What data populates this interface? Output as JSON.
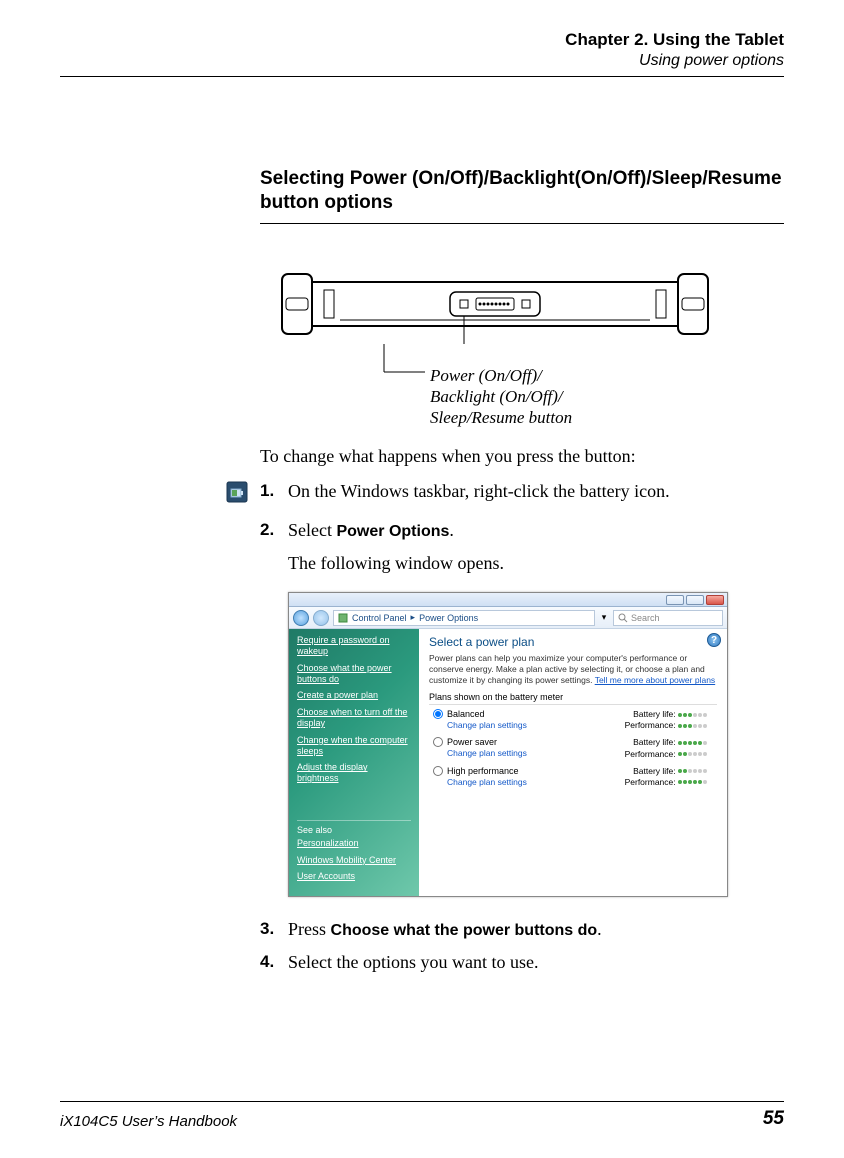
{
  "header": {
    "chapter": "Chapter 2. Using the Tablet",
    "subsection": "Using power options"
  },
  "heading": "Selecting Power (On/Off)/Backlight(On/Off)/Sleep/Resume button options",
  "callout": {
    "line1": "Power (On/Off)/",
    "line2": "Backlight (On/Off)/",
    "line3": "Sleep/Resume button"
  },
  "intro": "To change what happens when you press the button:",
  "steps": {
    "n1": "1.",
    "s1": "On the Windows taskbar, right-click the battery icon.",
    "n2": "2.",
    "s2_a": "Select ",
    "s2_b": "Power Options",
    "s2_c": ".",
    "s2_sub": "The following window opens.",
    "n3": "3.",
    "s3_a": "Press ",
    "s3_b": "Choose what the power buttons do",
    "s3_c": ".",
    "n4": "4.",
    "s4": "Select the options you want to use."
  },
  "screenshot": {
    "breadcrumb_a": "Control Panel",
    "breadcrumb_b": "Power Options",
    "search_placeholder": "Search",
    "help_mark": "?",
    "sidebar": {
      "items": [
        "Require a password on wakeup",
        "Choose what the power buttons do",
        "Create a power plan",
        "Choose when to turn off the display",
        "Change when the computer sleeps",
        "Adjust the display brightness"
      ],
      "seealso_hdr": "See also",
      "seealso": [
        "Personalization",
        "Windows Mobility Center",
        "User Accounts"
      ]
    },
    "main": {
      "title": "Select a power plan",
      "desc_a": "Power plans can help you maximize your computer's performance or conserve energy. Make a plan active by selecting it, or choose a plan and customize it by changing its power settings. ",
      "desc_link": "Tell me more about power plans",
      "plans_hdr": "Plans shown on the battery meter",
      "battery_lbl": "Battery life:",
      "perf_lbl": "Performance:",
      "change_link": "Change plan settings",
      "plans": [
        {
          "name": "Balanced",
          "checked": true,
          "bl": 3,
          "perf": 3
        },
        {
          "name": "Power saver",
          "checked": false,
          "bl": 5,
          "perf": 2
        },
        {
          "name": "High performance",
          "checked": false,
          "bl": 2,
          "perf": 5
        }
      ]
    }
  },
  "footer": {
    "left": "iX104C5 User’s Handbook",
    "right": "55"
  }
}
